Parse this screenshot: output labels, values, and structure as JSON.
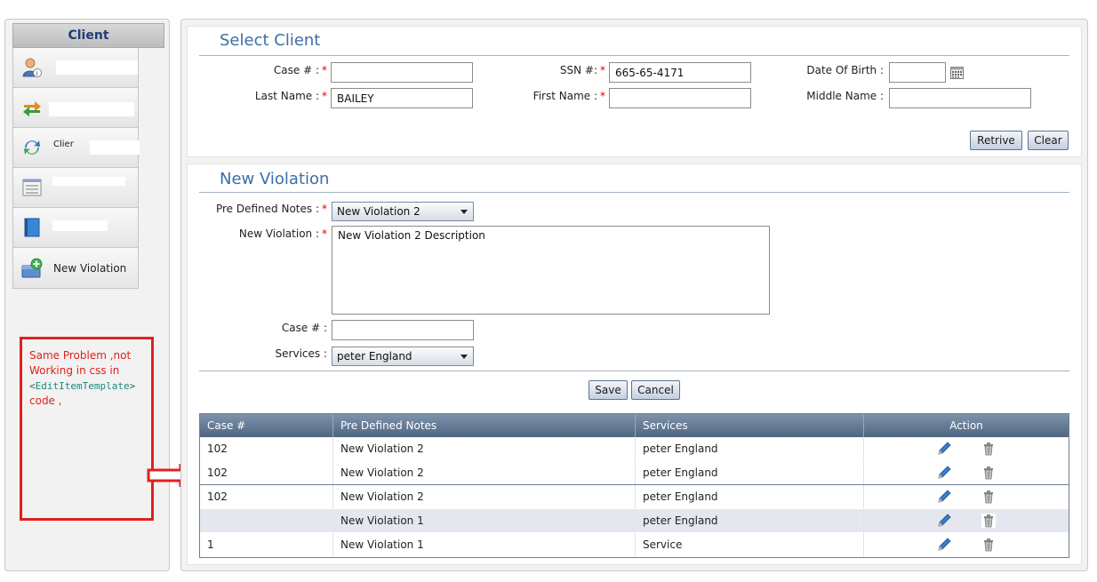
{
  "sidebar": {
    "header": "Client",
    "items": [
      {
        "label": "",
        "icon": "user-info-icon"
      },
      {
        "label": "",
        "icon": "transfer-icon"
      },
      {
        "label": "Clier",
        "icon": "refresh-icon"
      },
      {
        "label": "",
        "icon": "activity-list-icon"
      },
      {
        "label": "",
        "icon": "notebook-icon"
      },
      {
        "label": "New Violation",
        "icon": "new-violation-icon"
      }
    ]
  },
  "annotation": {
    "line1": "Same Problem ,not Working in css in",
    "code_open": "<",
    "code_tag": "EditItemTemplate",
    "code_close": ">",
    "line2": "code ,"
  },
  "select_client": {
    "title": "Select Client",
    "case_label": "Case # :",
    "case_value": "",
    "ssn_label": "SSN #:",
    "ssn_value": "665-65-4171",
    "dob_label": "Date Of Birth :",
    "dob_value": "",
    "last_name_label": "Last Name :",
    "last_name_value": "BAILEY",
    "first_name_label": "First Name :",
    "first_name_value": "",
    "middle_name_label": "Middle Name :",
    "middle_name_value": "",
    "required_mark": "*",
    "retrive_label": "Retrive",
    "clear_label": "Clear"
  },
  "new_violation": {
    "title": "New Violation",
    "predefined_label": "Pre Defined Notes :",
    "predefined_value": "New Violation 2",
    "violation_label": "New Violation :",
    "violation_value": "New Violation 2 Description",
    "case_label": "Case # :",
    "case_value": "",
    "services_label": "Services :",
    "services_value": "peter England",
    "save_label": "Save",
    "cancel_label": "Cancel"
  },
  "grid": {
    "columns": [
      "Case #",
      "Pre Defined Notes",
      "Services",
      "Action"
    ],
    "rows": [
      {
        "case": "102",
        "notes": "New Violation 2",
        "services": "peter England"
      },
      {
        "case": "102",
        "notes": "New Violation 2",
        "services": "peter England"
      },
      {
        "case": "102",
        "notes": "New Violation 2",
        "services": "peter England"
      },
      {
        "case": "",
        "notes": "New Violation 1",
        "services": "peter England"
      },
      {
        "case": "1",
        "notes": "New Violation 1",
        "services": "Service"
      }
    ]
  },
  "colors": {
    "accent": "#3b6ea5",
    "annotation": "#e0211f",
    "grid_header": "#5a6f8c",
    "required": "#dd0000"
  }
}
